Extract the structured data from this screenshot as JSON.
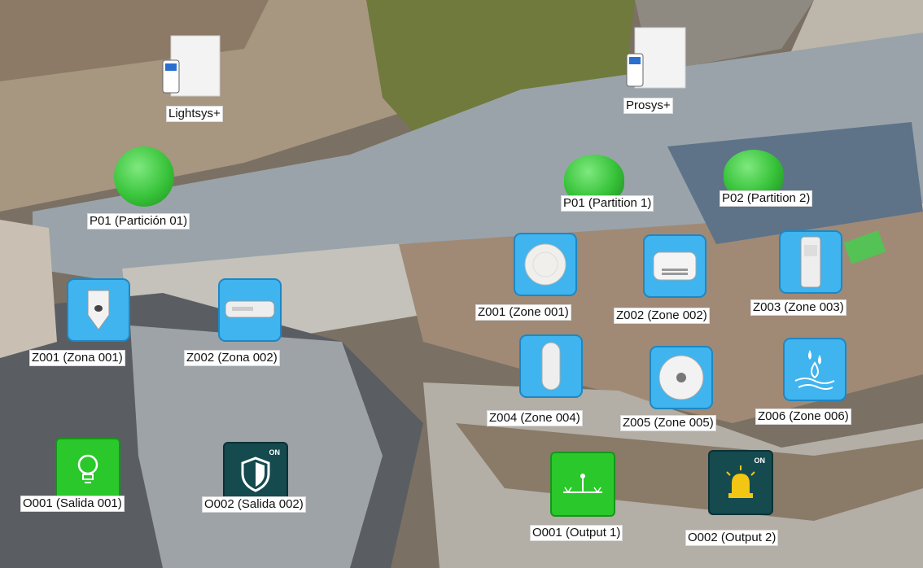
{
  "panels": [
    {
      "label": "Lightsys+",
      "icon": "alarm-panel-icon"
    },
    {
      "label": "Prosys+",
      "icon": "alarm-panel-icon"
    }
  ],
  "partitions": [
    {
      "label": "P01 (Partición 01)"
    },
    {
      "label": "P01 (Partition 1)"
    },
    {
      "label": "P02 (Partition 2)"
    }
  ],
  "zones": [
    {
      "label": "Z001 (Zona 001)",
      "icon": "pir-sensor-icon"
    },
    {
      "label": "Z002 (Zona 002)",
      "icon": "door-contact-icon"
    },
    {
      "label": "Z001 (Zone 001)",
      "icon": "smoke-detector-icon"
    },
    {
      "label": "Z002 (Zone 002)",
      "icon": "co-detector-icon"
    },
    {
      "label": "Z003 (Zone 003)",
      "icon": "outdoor-pir-icon"
    },
    {
      "label": "Z004 (Zone 004)",
      "icon": "pir-sensor-icon"
    },
    {
      "label": "Z005 (Zone 005)",
      "icon": "ceiling-detector-icon"
    },
    {
      "label": "Z006 (Zone 006)",
      "icon": "water-leak-icon"
    }
  ],
  "outputs": [
    {
      "label": "O001 (Salida 001)",
      "icon": "lightbulb-icon",
      "state": ""
    },
    {
      "label": "O002 (Salida 002)",
      "icon": "shield-icon",
      "state": "ON"
    },
    {
      "label": "O001 (Output 1)",
      "icon": "sprinkler-icon",
      "state": ""
    },
    {
      "label": "O002 (Output 2)",
      "icon": "siren-light-icon",
      "state": "ON"
    }
  ],
  "colors": {
    "zone_tile": "#3fb4ee",
    "partition_ok": "#39c43b",
    "output_on": "#2bc82b",
    "output_dark": "#154a4f"
  }
}
